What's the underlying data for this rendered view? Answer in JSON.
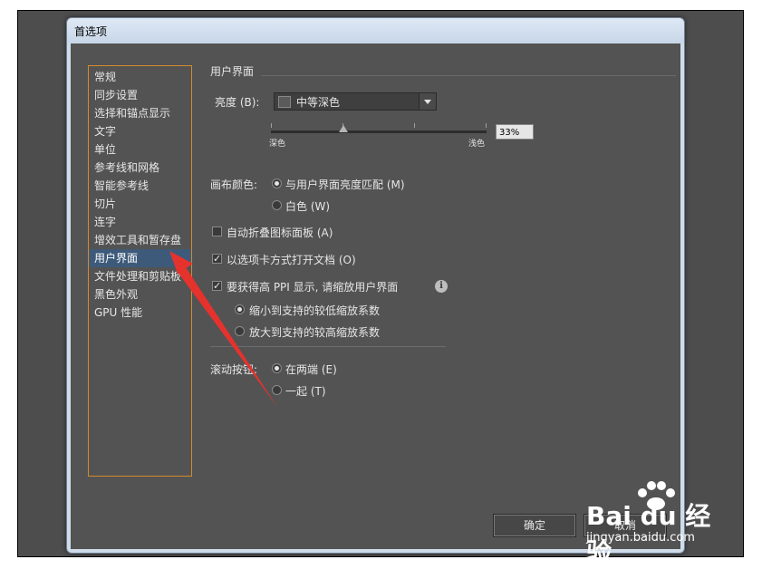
{
  "window": {
    "title": "首选项"
  },
  "sidebar": {
    "items": [
      {
        "label": "常规"
      },
      {
        "label": "同步设置"
      },
      {
        "label": "选择和锚点显示"
      },
      {
        "label": "文字"
      },
      {
        "label": "单位"
      },
      {
        "label": "参考线和网格"
      },
      {
        "label": "智能参考线"
      },
      {
        "label": "切片"
      },
      {
        "label": "连字"
      },
      {
        "label": "增效工具和暂存盘"
      },
      {
        "label": "用户界面",
        "selected": true
      },
      {
        "label": "文件处理和剪贴板"
      },
      {
        "label": "黑色外观"
      },
      {
        "label": "GPU 性能"
      }
    ]
  },
  "panel": {
    "section_title": "用户界面",
    "brightness": {
      "label": "亮度 (B):",
      "value": "中等深色",
      "slider_min_label": "深色",
      "slider_max_label": "浅色",
      "percent": "33%"
    },
    "canvas_color": {
      "label": "画布颜色:",
      "options": [
        {
          "label": "与用户界面亮度匹配 (M)",
          "checked": true
        },
        {
          "label": "白色 (W)",
          "checked": false
        }
      ]
    },
    "auto_collapse": {
      "label": "自动折叠图标面板 (A)",
      "checked": false
    },
    "open_tabs": {
      "label": "以选项卡方式打开文档 (O)",
      "checked": true
    },
    "high_ppi": {
      "label": "要获得高 PPI 显示, 请缩放用户界面",
      "checked": true,
      "info_icon": "i",
      "options": [
        {
          "label": "缩小到支持的较低缩放系数",
          "checked": true
        },
        {
          "label": "放大到支持的较高缩放系数",
          "checked": false
        }
      ]
    },
    "scroll_buttons": {
      "label": "滚动按钮:",
      "options": [
        {
          "label": "在两端 (E)",
          "checked": true
        },
        {
          "label": "一起 (T)",
          "checked": false
        }
      ]
    }
  },
  "buttons": {
    "ok": "确定",
    "cancel": "取消"
  },
  "watermark": {
    "brand": "Bai du 经验",
    "url": "jingyan.baidu.com"
  },
  "colors": {
    "panel_bg": "#535353",
    "nav_border": "#d48a2e",
    "selection": "#3d5a7a",
    "annotation_arrow": "#e5322d"
  }
}
